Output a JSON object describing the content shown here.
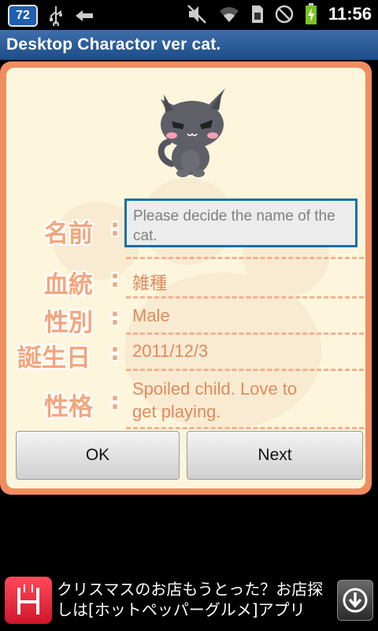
{
  "status_bar": {
    "notification_count": "72",
    "time": "11:56",
    "icons": [
      "usb-icon",
      "back-arrow-icon",
      "mute-icon",
      "wifi-icon",
      "sim-icon",
      "no-signal-icon",
      "battery-charging-icon"
    ]
  },
  "app_title": "Desktop Charactor ver cat.",
  "fields": [
    {
      "label": "名前",
      "placeholder": "Please decide the name of the cat."
    },
    {
      "label": "血統",
      "value": "雑種"
    },
    {
      "label": "性別",
      "value": "Male"
    },
    {
      "label": "誕生日",
      "value": "2011/12/3"
    },
    {
      "label": "性格",
      "value_line1": "Spoiled child. Love to",
      "value_line2": "get playing."
    }
  ],
  "buttons": {
    "ok": "OK",
    "next": "Next"
  },
  "ad": {
    "line1": "クリスマスのお店もうとった？お店探",
    "line2": "しは[ホットペッパーグルメ]アプリ",
    "icon": "hotpepper-fork-icon",
    "download_icon": "download-icon"
  },
  "colors": {
    "panel_border": "#f08d5f",
    "panel_bg": "#fdf6dc",
    "label": "#f3a57c",
    "value": "#e08a5e",
    "title_bar": "#2a5a96"
  }
}
